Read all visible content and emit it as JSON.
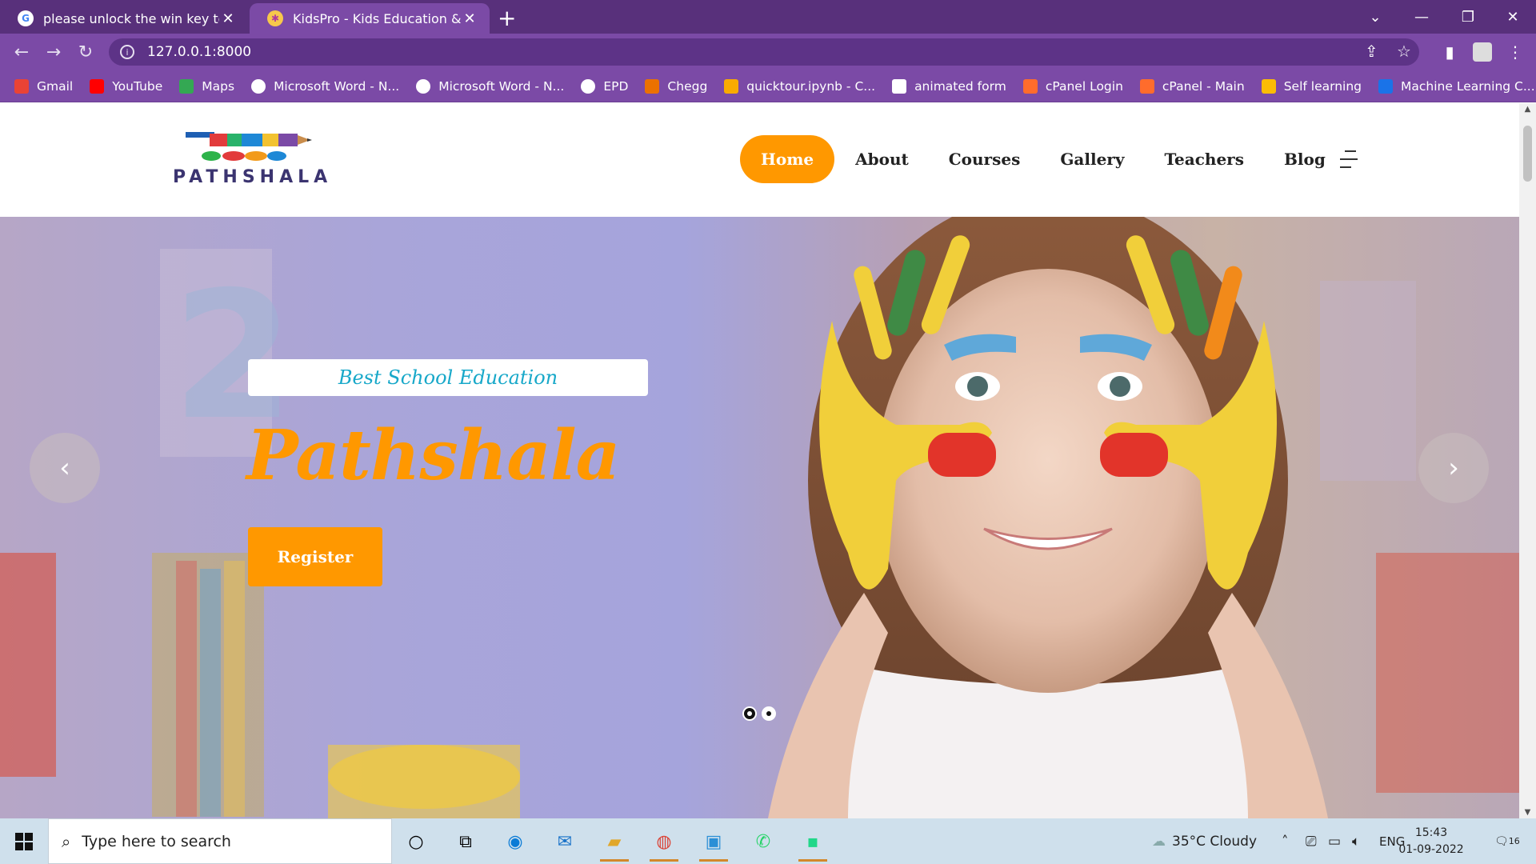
{
  "browser": {
    "tabs": [
      {
        "title": "please unlock the win key to activate",
        "favicon": "google-icon",
        "close": "✕"
      },
      {
        "title": "KidsPro - Kids Education & Kindergarten",
        "favicon": "kidspro-icon",
        "close": "✕"
      }
    ],
    "new_tab": "+",
    "url": "127.0.0.1:8000",
    "bookmarks": [
      {
        "label": "Gmail",
        "icon": "gmail-icon",
        "color": "#ea4335"
      },
      {
        "label": "YouTube",
        "icon": "youtube-icon",
        "color": "#ff0000"
      },
      {
        "label": "Maps",
        "icon": "maps-icon",
        "color": "#34a853"
      },
      {
        "label": "Microsoft Word - N...",
        "icon": "globe-icon",
        "color": "#ffffff"
      },
      {
        "label": "Microsoft Word - N...",
        "icon": "globe-icon",
        "color": "#ffffff"
      },
      {
        "label": "EPD",
        "icon": "globe-icon",
        "color": "#ffffff"
      },
      {
        "label": "Chegg",
        "icon": "chegg-icon",
        "color": "#eb7100"
      },
      {
        "label": "quicktour.ipynb - C...",
        "icon": "colab-icon",
        "color": "#f9ab00"
      },
      {
        "label": "animated form",
        "icon": "codepen-icon",
        "color": "#ffffff"
      },
      {
        "label": "cPanel Login",
        "icon": "cpanel-icon",
        "color": "#ff6c2c"
      },
      {
        "label": "cPanel - Main",
        "icon": "cpanel-icon",
        "color": "#ff6c2c"
      },
      {
        "label": "Self learning",
        "icon": "chart-icon",
        "color": "#fbbc04"
      },
      {
        "label": "Machine Learning C...",
        "icon": "is-icon",
        "color": "#1a73e8"
      }
    ]
  },
  "site": {
    "logo_text": "PATHSHALA",
    "nav": [
      "Home",
      "About",
      "Courses",
      "Gallery",
      "Teachers",
      "Blog"
    ],
    "accent": "#ff9800",
    "hero": {
      "tagline": "Best School Education",
      "title": "Pathshala",
      "cta": "Register",
      "prev": "‹",
      "next": "›",
      "slides": 2,
      "active_slide": 1
    }
  },
  "taskbar": {
    "search_placeholder": "Type here to search",
    "weather": "35°C  Cloudy",
    "language": "ENG",
    "time": "15:43",
    "date": "01-09-2022",
    "notifications": "16"
  }
}
